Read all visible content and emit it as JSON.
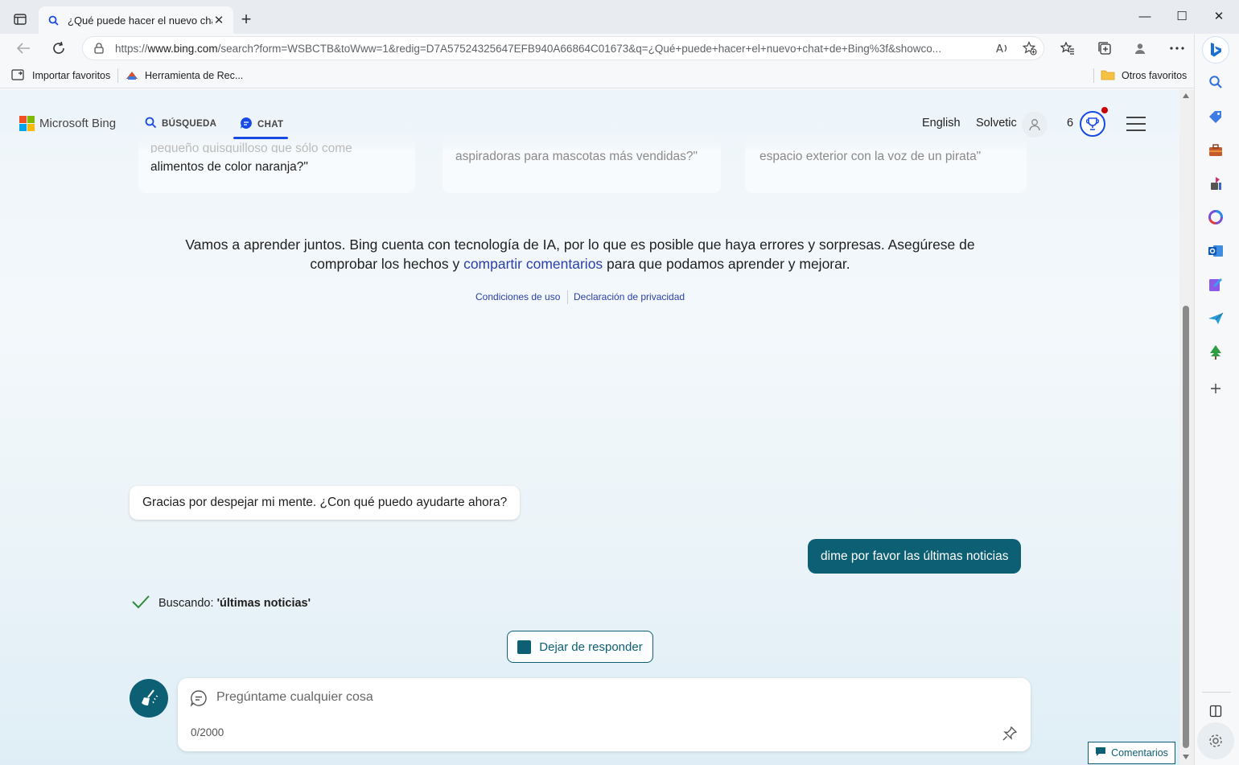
{
  "browser": {
    "tab": {
      "title": "¿Qué puede hacer el nuevo chat",
      "close": "✕"
    },
    "new_tab": "+",
    "window_controls": {
      "minimize": "—",
      "maximize": "☐",
      "close": "✕"
    },
    "url": {
      "host_prefix": "https://",
      "host": "www.bing.com",
      "path": "/search?form=WSBCTB&toWww=1&redig=D7A57524325647EFB940A66864C01673&q=¿Qué+puede+hacer+el+nuevo+chat+de+Bing%3f&showco..."
    },
    "favorites": [
      {
        "label": "Importar favoritos"
      },
      {
        "label": "Herramienta de Rec..."
      }
    ],
    "other_favorites": "Otros favoritos",
    "sidebar_icons": [
      "search-icon",
      "tag-icon",
      "briefcase-icon",
      "games-icon",
      "office-icon",
      "outlook-icon",
      "designer-icon",
      "send-icon",
      "tree-icon",
      "add-icon",
      "split-view-icon",
      "settings-icon"
    ]
  },
  "header": {
    "logo_text": "Microsoft Bing",
    "nav": {
      "search": "BÚSQUEDA",
      "chat": "CHAT"
    },
    "language": "English",
    "user_name": "Solvetic",
    "rewards_count": "6"
  },
  "cards": [
    {
      "line1": "pequeño quisquilloso que sólo come",
      "line2": "alimentos de color naranja?\""
    },
    {
      "line1": "aspiradoras para mascotas más vendidas?\""
    },
    {
      "line1": "espacio exterior con la voz de un pirata\""
    }
  ],
  "disclaimer": {
    "text_before": "Vamos a aprender juntos. Bing cuenta con tecnología de IA, por lo que es posible que haya errores y sorpresas. Asegúrese de comprobar los hechos y ",
    "link": "compartir comentarios",
    "text_after": " para que podamos aprender y mejorar."
  },
  "legal": {
    "terms": "Condiciones de uso",
    "privacy": "Declaración de privacidad"
  },
  "messages": {
    "bot": "Gracias por despejar mi mente. ¿Con qué puedo ayudarte ahora?",
    "user": "dime por favor las últimas noticias"
  },
  "searching": {
    "prefix": "Buscando: ",
    "query": "'últimas noticias'"
  },
  "stop_button": "Dejar de responder",
  "input": {
    "placeholder": "Pregúntame cualquier cosa",
    "counter": "0/2000"
  },
  "feedback": "Comentarios",
  "colors": {
    "accent": "#0d5f74",
    "link": "#2b3fa8",
    "chat_blue": "#174ae4"
  }
}
